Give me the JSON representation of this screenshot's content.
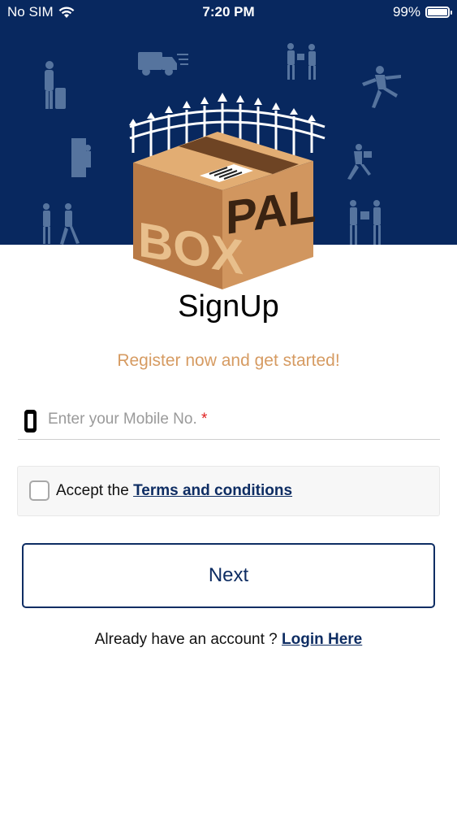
{
  "status_bar": {
    "carrier": "No SIM",
    "time": "7:20 PM",
    "battery": "99%"
  },
  "header": {
    "background_color": "#08285f",
    "logo_text_left": "BOX",
    "logo_text_right": "PAL"
  },
  "signup": {
    "title": "SignUp",
    "subtitle": "Register now and get started!",
    "mobile_placeholder": "Enter your Mobile No.",
    "required_marker": "*",
    "terms_prefix": "Accept the",
    "terms_link": "Terms and conditions",
    "next_label": "Next",
    "login_prompt": "Already have an account ?",
    "login_link": "Login Here"
  },
  "colors": {
    "accent": "#0e2d63",
    "subtitle": "#d69b62",
    "required": "#e02020"
  }
}
